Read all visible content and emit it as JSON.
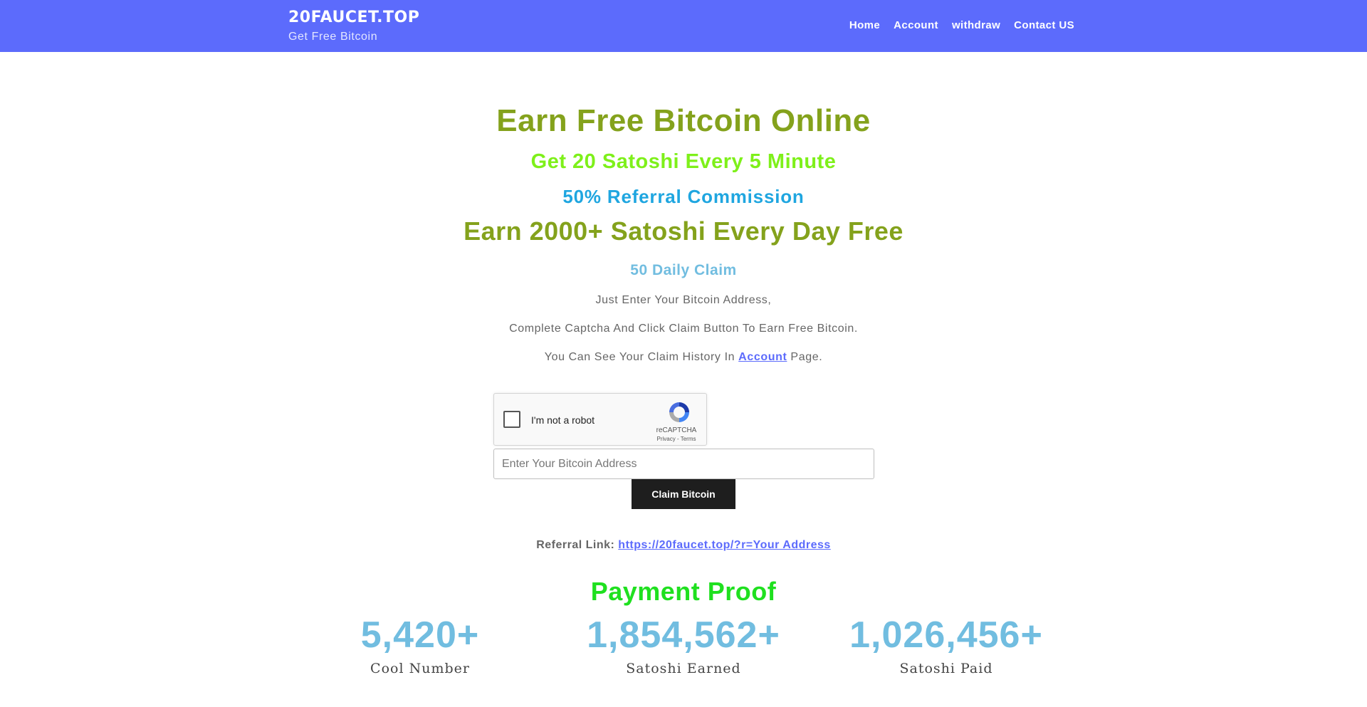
{
  "header": {
    "brand_title": "20FAUCET.TOP",
    "brand_subtitle": "Get Free Bitcoin",
    "nav": [
      "Home",
      "Account",
      "withdraw",
      "Contact US"
    ]
  },
  "hero": {
    "title": "Earn Free Bitcoin Online",
    "line2": "Get 20 Satoshi Every 5 Minute",
    "line3": "50% Referral Commission",
    "line4": "Earn 2000+ Satoshi Every Day Free",
    "line5": "50 Daily Claim",
    "p1": "Just Enter Your Bitcoin Address,",
    "p2": "Complete Captcha And Click Claim Button To Earn Free Bitcoin.",
    "p3_prefix": "You Can See Your Claim History In",
    "p3_link": "Account",
    "p3_suffix": "Page."
  },
  "captcha": {
    "label": "I'm not a robot",
    "brand": "reCAPTCHA",
    "links": "Privacy - Terms"
  },
  "form": {
    "address_placeholder": "Enter Your Bitcoin Address",
    "claim_label": "Claim Bitcoin"
  },
  "referral": {
    "label": "Referral Link:",
    "link": "https://20faucet.top/?r=Your Address"
  },
  "proof": {
    "title": "Payment Proof",
    "stats": [
      {
        "value": "5,420+",
        "label": "Cool Number"
      },
      {
        "value": "1,854,562+",
        "label": "Satoshi Earned"
      },
      {
        "value": "1,026,456+",
        "label": "Satoshi Paid"
      }
    ]
  },
  "colors": {
    "header_bg": "#5c6bfc",
    "olive": "#84a21c",
    "lime": "#7ef01a",
    "blue": "#1fa6e0",
    "light_blue": "#71bde0",
    "green": "#1fe01f"
  }
}
